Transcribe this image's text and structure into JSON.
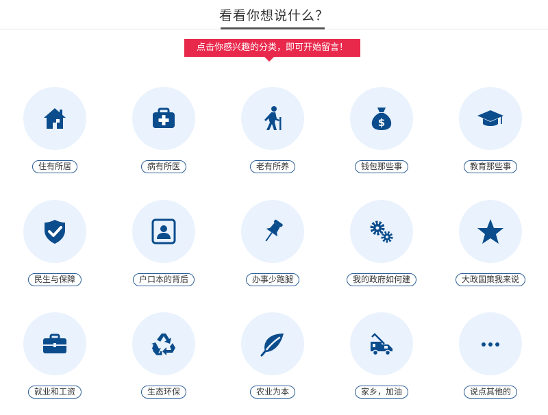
{
  "header": {
    "title": "看看你想说什么？"
  },
  "banner": {
    "text": "点击你感兴趣的分类，即可开始留言！"
  },
  "colors": {
    "accent": "#e8294c",
    "icon": "#0b4c8c",
    "circle_bg": "#e9f2fd"
  },
  "categories": [
    {
      "label": "住有所居",
      "icon": "house-icon"
    },
    {
      "label": "病有所医",
      "icon": "medical-kit-icon"
    },
    {
      "label": "老有所养",
      "icon": "elderly-person-icon"
    },
    {
      "label": "钱包那些事",
      "icon": "money-bag-icon"
    },
    {
      "label": "教育那些事",
      "icon": "graduation-cap-icon"
    },
    {
      "label": "民生与保障",
      "icon": "shield-check-icon"
    },
    {
      "label": "户口本的背后",
      "icon": "id-card-icon"
    },
    {
      "label": "办事少跑腿",
      "icon": "pushpin-icon"
    },
    {
      "label": "我的政府如何建",
      "icon": "gears-icon"
    },
    {
      "label": "大政国策我来说",
      "icon": "star-icon"
    },
    {
      "label": "就业和工资",
      "icon": "briefcase-icon"
    },
    {
      "label": "生态环保",
      "icon": "recycle-icon"
    },
    {
      "label": "农业为本",
      "icon": "leaf-icon"
    },
    {
      "label": "家乡，加油",
      "icon": "truck-icon"
    },
    {
      "label": "说点其他的",
      "icon": "ellipsis-icon"
    }
  ]
}
